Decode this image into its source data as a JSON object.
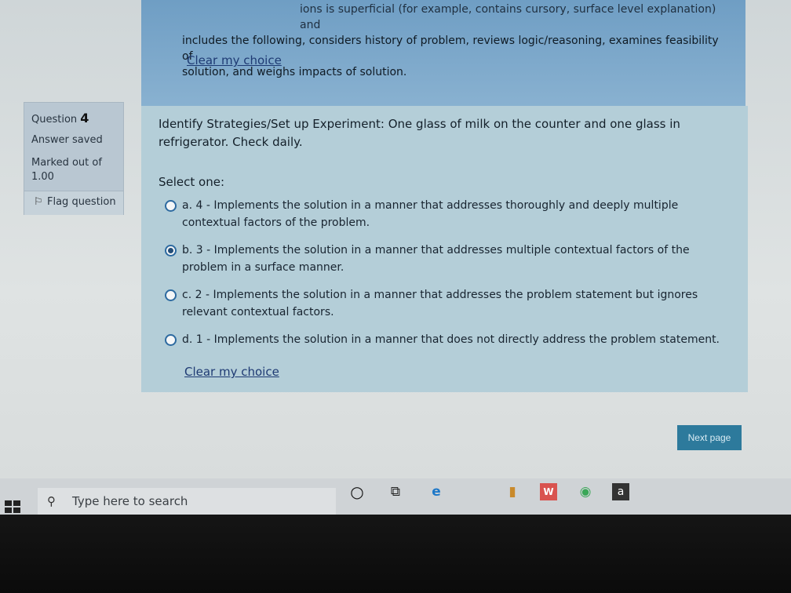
{
  "previous_question": {
    "top_fragment": "ions is superficial (for example, contains cursory, surface level explanation) and",
    "line2": "includes the following, considers history of problem, reviews logic/reasoning, examines feasibility of",
    "line3": "solution, and weighs impacts of solution.",
    "clear_label": "Clear my choice"
  },
  "question_info": {
    "question_label": "Question",
    "question_number": "4",
    "status": "Answer saved",
    "marked_label": "Marked out of",
    "marked_value": "1.00",
    "flag_label": "Flag question"
  },
  "question": {
    "text": "Identify Strategies/Set up Experiment: One glass of milk on the counter and one glass in refrigerator. Check daily.",
    "select_label": "Select one:",
    "options": [
      {
        "label": "a. 4 - Implements the solution in a manner that addresses thoroughly and deeply multiple contextual factors of the problem.",
        "selected": false
      },
      {
        "label": "b. 3 - Implements the solution in a manner that addresses multiple contextual factors of the problem in a surface manner.",
        "selected": true
      },
      {
        "label": "c. 2 - Implements the solution in a manner that addresses the problem statement but ignores relevant contextual factors.",
        "selected": false
      },
      {
        "label": "d. 1 - Implements the solution in a manner that does not directly address the problem statement.",
        "selected": false
      }
    ],
    "clear_label": "Clear my choice"
  },
  "navigation": {
    "next_label": "Next page"
  },
  "taskbar": {
    "search_placeholder": "Type here to search",
    "icons": [
      "windows-start-icon",
      "cortana-icon",
      "task-view-icon",
      "edge-icon",
      "winrar-icon",
      "wps-icon",
      "chrome-icon",
      "amazon-icon"
    ],
    "amazon_letter": "a",
    "wps_letter": "W"
  },
  "colors": {
    "panel_blue": "#b4ced8",
    "prev_panel_blue": "#7ea8c9",
    "link": "#1e3a73",
    "next_button": "#2d7a9c"
  }
}
